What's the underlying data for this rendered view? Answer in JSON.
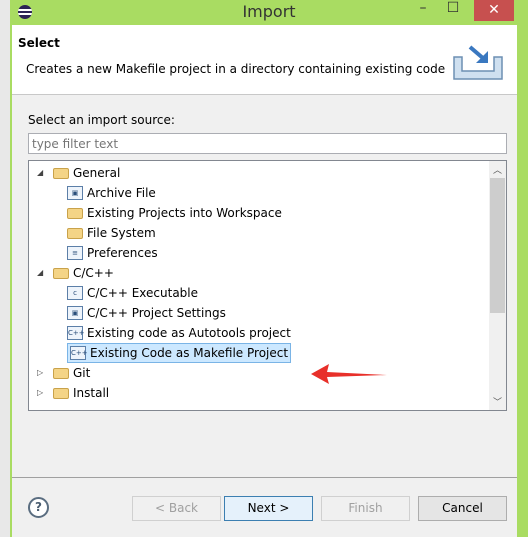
{
  "window": {
    "title": "Import",
    "minimize": "–",
    "maximize": "☐",
    "close": "✕"
  },
  "header": {
    "title": "Select",
    "description": "Creates a new Makefile project in a directory containing existing code"
  },
  "source_label": "Select an import source:",
  "filter": {
    "value": "",
    "placeholder": "type filter text"
  },
  "tree": [
    {
      "label": "General",
      "level": 0,
      "type": "folder",
      "expanded": true
    },
    {
      "label": "Archive File",
      "level": 1,
      "type": "archive"
    },
    {
      "label": "Existing Projects into Workspace",
      "level": 1,
      "type": "projects"
    },
    {
      "label": "File System",
      "level": 1,
      "type": "filesystem"
    },
    {
      "label": "Preferences",
      "level": 1,
      "type": "preferences"
    },
    {
      "label": "C/C++",
      "level": 0,
      "type": "folder",
      "expanded": true
    },
    {
      "label": "C/C++ Executable",
      "level": 1,
      "type": "c-file"
    },
    {
      "label": "C/C++ Project Settings",
      "level": 1,
      "type": "settings"
    },
    {
      "label": "Existing code as Autotools project",
      "level": 1,
      "type": "cpp-file"
    },
    {
      "label": "Existing Code as Makefile Project",
      "level": 1,
      "type": "cpp-file",
      "selected": true
    },
    {
      "label": "Git",
      "level": 0,
      "type": "folder",
      "expanded": false
    },
    {
      "label": "Install",
      "level": 0,
      "type": "folder",
      "expanded": false
    }
  ],
  "buttons": {
    "help": "?",
    "back": "< Back",
    "next": "Next >",
    "finish": "Finish",
    "cancel": "Cancel"
  },
  "colors": {
    "frame": "#a9dc62",
    "close": "#c7504f",
    "selection": "#cce8ff",
    "annotation_arrow": "#e8302a"
  }
}
